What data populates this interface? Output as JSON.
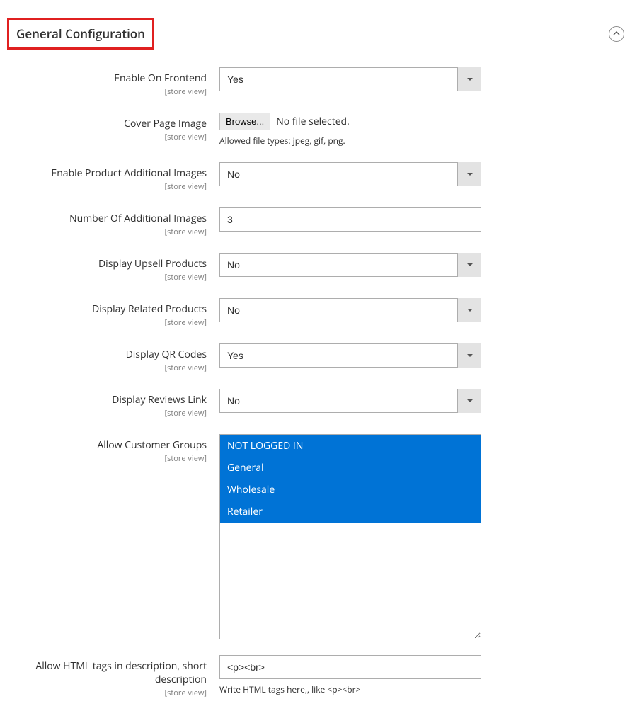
{
  "section": {
    "title": "General Configuration"
  },
  "scope_label": "[store view]",
  "fields": {
    "enable_frontend": {
      "label": "Enable On Frontend",
      "value": "Yes"
    },
    "cover_page_image": {
      "label": "Cover Page Image",
      "browse": "Browse...",
      "status": "No file selected.",
      "hint": "Allowed file types: jpeg, gif, png."
    },
    "enable_additional_images": {
      "label": "Enable Product Additional Images",
      "value": "No"
    },
    "number_additional_images": {
      "label": "Number Of Additional Images",
      "value": "3"
    },
    "display_upsell": {
      "label": "Display Upsell Products",
      "value": "No"
    },
    "display_related": {
      "label": "Display Related Products",
      "value": "No"
    },
    "display_qr": {
      "label": "Display QR Codes",
      "value": "Yes"
    },
    "display_reviews": {
      "label": "Display Reviews Link",
      "value": "No"
    },
    "customer_groups": {
      "label": "Allow Customer Groups",
      "options": [
        "NOT LOGGED IN",
        "General",
        "Wholesale",
        "Retailer"
      ]
    },
    "allow_html": {
      "label": "Allow HTML tags in description, short description",
      "value": "<p><br>",
      "hint": "Write HTML tags here,, like <p><br>"
    }
  }
}
